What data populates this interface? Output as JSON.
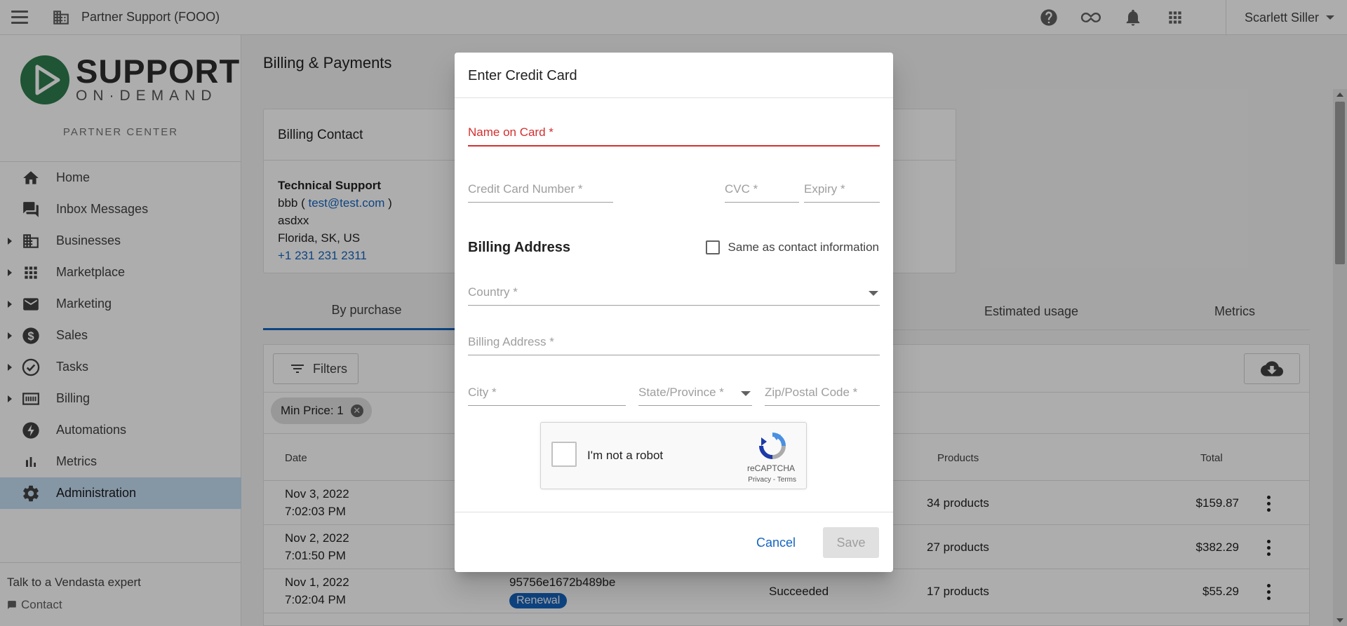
{
  "topbar": {
    "app_title": "Partner Support (FOOO)",
    "icons": [
      "help-icon",
      "infinity-icon",
      "bell-icon",
      "apps-grid-icon"
    ],
    "user_name": "Scarlett Siller"
  },
  "sidebar": {
    "logo_top": "SUPPORT",
    "logo_bottom": "ON·DEMAND",
    "subtitle": "PARTNER CENTER",
    "items": [
      {
        "label": "Home",
        "icon": "home-icon"
      },
      {
        "label": "Inbox Messages",
        "icon": "chat-icon"
      },
      {
        "label": "Businesses",
        "icon": "building-icon"
      },
      {
        "label": "Marketplace",
        "icon": "grid-icon"
      },
      {
        "label": "Marketing",
        "icon": "mail-icon"
      },
      {
        "label": "Sales",
        "icon": "dollar-icon"
      },
      {
        "label": "Tasks",
        "icon": "check-circle-icon"
      },
      {
        "label": "Billing",
        "icon": "billing-icon"
      },
      {
        "label": "Automations",
        "icon": "bolt-icon"
      },
      {
        "label": "Metrics",
        "icon": "bar-chart-icon"
      },
      {
        "label": "Administration",
        "icon": "gear-icon"
      }
    ],
    "footer_expert": "Talk to a Vendasta expert",
    "footer_contact": "Contact"
  },
  "main": {
    "page_title": "Billing & Payments",
    "billing_contact": {
      "title": "Billing Contact",
      "name": "Technical Support",
      "line_prefix": "bbb ( ",
      "email": "test@test.com",
      "line_suffix": " )",
      "address": "asdxx",
      "city": "Florida, SK, US",
      "phone": "+1 231 231 2311"
    },
    "tabs": [
      "By purchase",
      "Estimated usage",
      "Metrics"
    ],
    "filters_label": "Filters",
    "chip_label": "Min Price: 1",
    "columns": {
      "date": "Date",
      "products": "Products",
      "total": "Total"
    },
    "rows": [
      {
        "date": "Nov 3, 2022",
        "time": "7:02:03 PM",
        "products": "34 products",
        "total": "$159.87"
      },
      {
        "date": "Nov 2, 2022",
        "time": "7:01:50 PM",
        "products": "27 products",
        "total": "$382.29"
      },
      {
        "date": "Nov 1, 2022",
        "time": "7:02:04 PM",
        "id": "95756e1672b489be",
        "badge": "Renewal",
        "status": "Succeeded",
        "products": "17 products",
        "total": "$55.29"
      }
    ]
  },
  "dialog": {
    "title": "Enter Credit Card",
    "fields": {
      "name_on_card": "Name on Card *",
      "card_number": "Credit Card Number *",
      "cvc": "CVC *",
      "expiry": "Expiry *",
      "country": "Country *",
      "billing_address": "Billing Address *",
      "city": "City *",
      "state": "State/Province *",
      "zip": "Zip/Postal Code *"
    },
    "section_title": "Billing Address",
    "same_as_contact": "Same as contact information",
    "captcha": {
      "label": "I'm not a robot",
      "brand": "reCAPTCHA",
      "links": "Privacy - Terms"
    },
    "cancel": "Cancel",
    "save": "Save"
  },
  "colors": {
    "accent": "#1565c0",
    "error": "#d32f2f",
    "active_nav": "#c5ddf4",
    "logo_green": "#2e7d4f"
  }
}
